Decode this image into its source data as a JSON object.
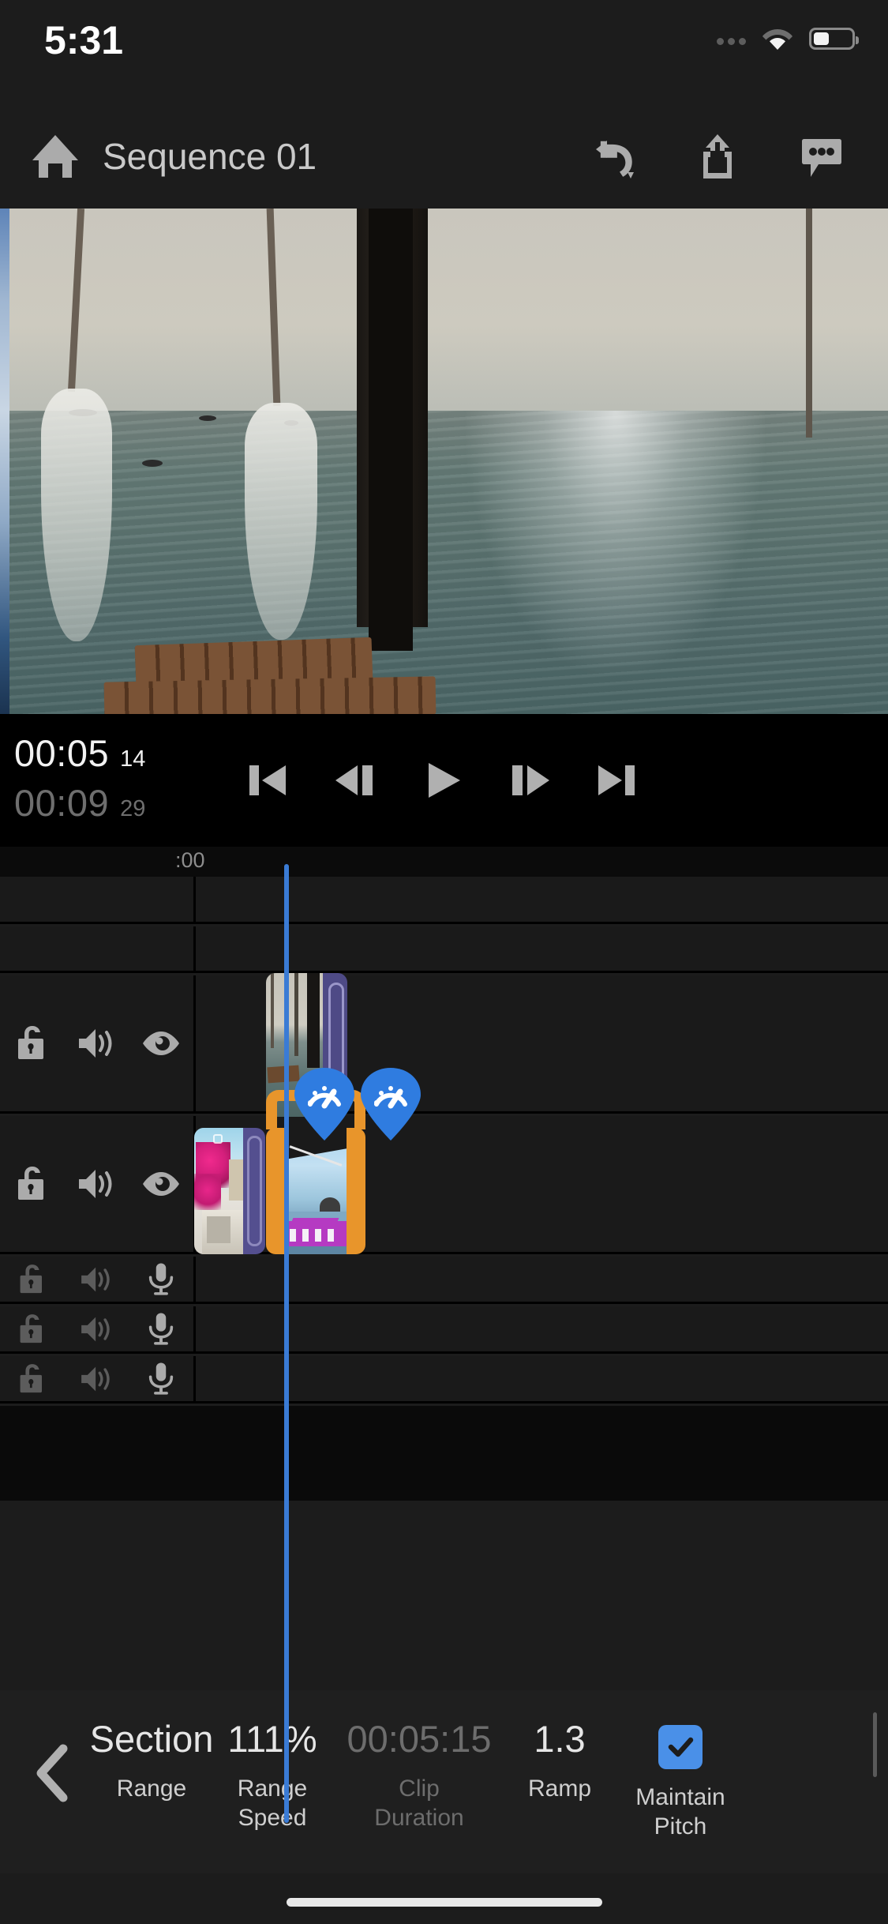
{
  "status_bar": {
    "time": "5:31",
    "icons": [
      "cellular-dots-icon",
      "wifi-icon",
      "battery-icon"
    ],
    "battery_level_pct": 36
  },
  "nav_bar": {
    "home_icon": "home-icon",
    "title": "Sequence 01",
    "actions": [
      {
        "name": "undo-icon",
        "label": "Undo"
      },
      {
        "name": "share-icon",
        "label": "Share"
      },
      {
        "name": "comment-icon",
        "label": "Comments"
      }
    ]
  },
  "preview": {
    "name": "video-preview",
    "description": "Seaside pier view with ropes, nets, wooden post and ocean"
  },
  "transport": {
    "current_timecode": "00:05",
    "current_frames": "14",
    "total_timecode": "00:09",
    "total_frames": "29",
    "buttons": [
      {
        "name": "skip-to-start-button",
        "label": "Go to start"
      },
      {
        "name": "step-back-button",
        "label": "Step back"
      },
      {
        "name": "play-button",
        "label": "Play"
      },
      {
        "name": "step-forward-button",
        "label": "Step forward"
      },
      {
        "name": "skip-to-end-button",
        "label": "Go to end"
      }
    ]
  },
  "timeline": {
    "ruler_label": ":00",
    "playhead_color": "#3a7bd5",
    "selection_color": "#e8952b",
    "tracks": [
      {
        "type": "empty",
        "icons": []
      },
      {
        "type": "empty",
        "icons": []
      },
      {
        "type": "video",
        "icons": [
          "unlock-icon",
          "speaker-icon",
          "eye-icon"
        ]
      },
      {
        "type": "video",
        "icons": [
          "unlock-icon",
          "speaker-icon",
          "eye-icon"
        ]
      },
      {
        "type": "audio",
        "icons": [
          "unlock-icon",
          "speaker-icon",
          "microphone-icon"
        ]
      },
      {
        "type": "audio",
        "icons": [
          "unlock-icon",
          "speaker-icon",
          "microphone-icon"
        ]
      },
      {
        "type": "audio",
        "icons": [
          "unlock-icon",
          "speaker-icon",
          "microphone-icon"
        ]
      }
    ],
    "speed_markers": [
      {
        "name": "speed-marker-icon",
        "label": "Speed"
      },
      {
        "name": "speed-marker-icon",
        "label": "Speed"
      }
    ]
  },
  "bottom_bar": {
    "back_icon": "chevron-left-icon",
    "items": [
      {
        "value": "Section",
        "label": "Range",
        "dim": false,
        "name": "range-control"
      },
      {
        "value": "111%",
        "label": "Range\nSpeed",
        "dim": false,
        "name": "range-speed-control"
      },
      {
        "value": "00:05:15",
        "label": "Clip\nDuration",
        "dim": true,
        "name": "clip-duration-control"
      },
      {
        "value": "1.3",
        "label": "Ramp",
        "dim": false,
        "name": "ramp-control"
      }
    ],
    "checkbox": {
      "label": "Maintain\nPitch",
      "checked": true,
      "color": "#4a90e8",
      "name": "maintain-pitch-checkbox"
    }
  }
}
